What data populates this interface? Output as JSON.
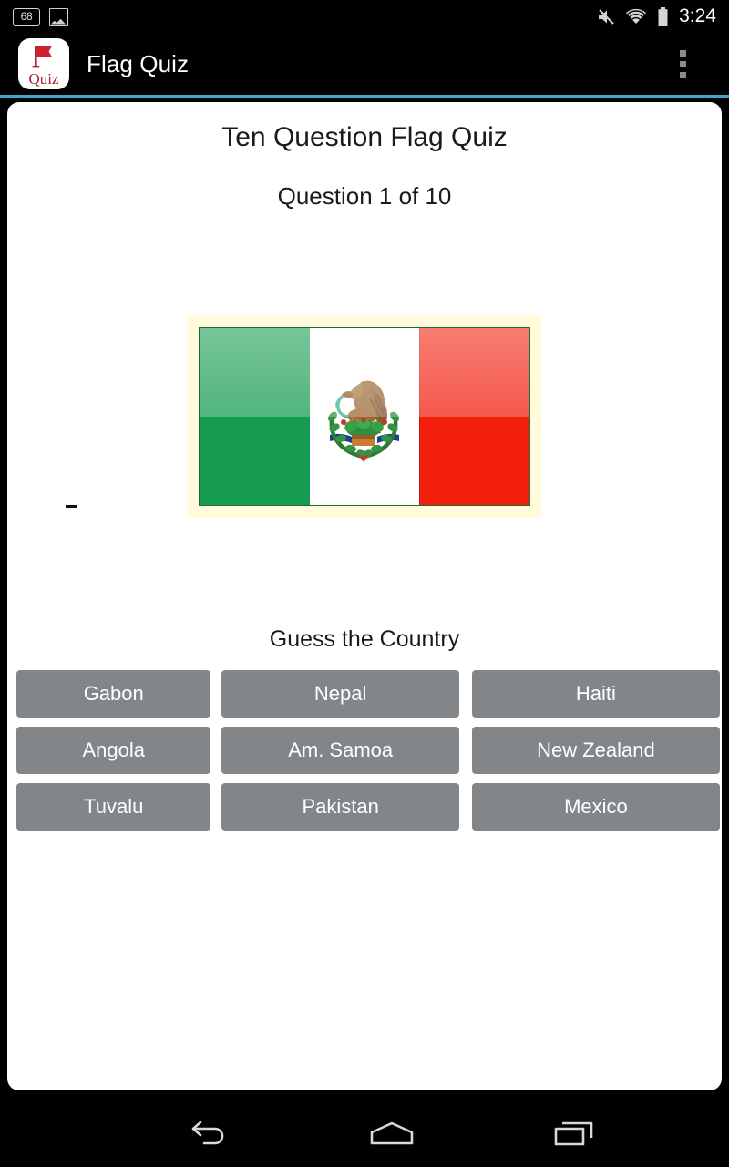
{
  "status_bar": {
    "notification_count": "68",
    "icons": [
      {
        "name": "notification-count-icon",
        "label": "68"
      },
      {
        "name": "gallery-image-icon",
        "label": "image"
      },
      {
        "name": "volume-mute-icon",
        "label": "muted"
      },
      {
        "name": "wifi-icon",
        "label": "wifi"
      },
      {
        "name": "battery-icon",
        "label": "battery"
      }
    ],
    "time": "3:24"
  },
  "action_bar": {
    "app_icon_name": "flag-quiz-app-icon",
    "app_icon_word": "Quiz",
    "title": "Flag Quiz",
    "overflow_label": "More options",
    "accent_color": "#41a4cd"
  },
  "quiz": {
    "title": "Ten Question Flag Quiz",
    "question_counter": "Question 1 of 10",
    "current_question": 1,
    "total_questions": 10,
    "prompt": "Guess the Country",
    "flag": {
      "country": "Mexico",
      "alt": "Flag of Mexico",
      "frame_color": "#fffbdb",
      "band_colors": [
        "#169b50",
        "#ffffff",
        "#f21f0d"
      ]
    },
    "answers": [
      [
        "Gabon",
        "Nepal",
        "Haiti"
      ],
      [
        "Angola",
        "Am. Samoa",
        "New Zealand"
      ],
      [
        "Tuvalu",
        "Pakistan",
        "Mexico"
      ]
    ],
    "button_color": "#838689",
    "button_text_color": "#ffffff"
  },
  "nav_bar": {
    "back_label": "Back",
    "home_label": "Home",
    "recents_label": "Recent apps"
  }
}
